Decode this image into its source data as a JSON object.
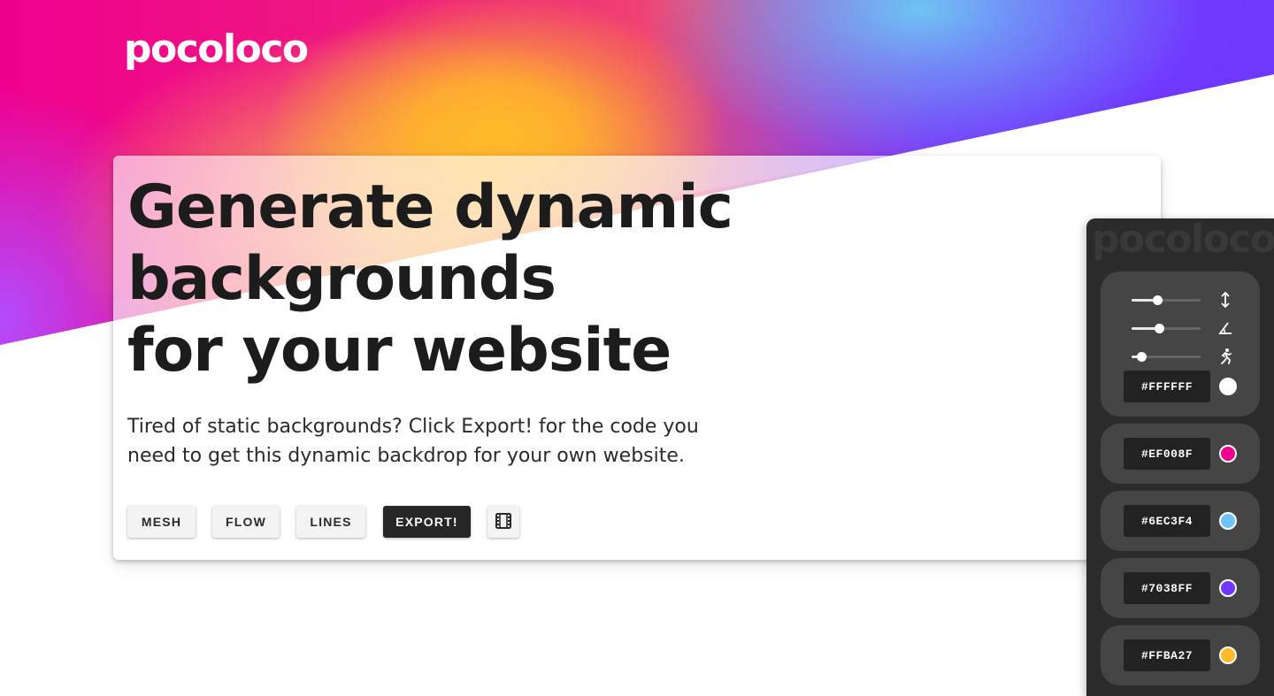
{
  "brand": {
    "logo": "pocoloco"
  },
  "hero": {
    "headline_lines": [
      "Generate dynamic",
      "backgrounds",
      "for your website"
    ],
    "subtext": "Tired of static backgrounds? Click Export! for the code you need to get this dynamic backdrop for your own website."
  },
  "buttons": {
    "mesh": "MESH",
    "flow": "FLOW",
    "lines": "LINES",
    "export": "EXPORT!",
    "fullscreen_icon": "film-icon"
  },
  "panel": {
    "watermark": "pocoloco",
    "sliders": [
      {
        "name": "scale",
        "icon": "vertical-arrows-icon",
        "value": 0.37
      },
      {
        "name": "angle",
        "icon": "angle-icon",
        "value": 0.4
      },
      {
        "name": "speed",
        "icon": "running-person-icon",
        "value": 0.14
      }
    ],
    "colors": [
      {
        "hex_label": "#FFFFFF",
        "hex": "#FFFFFF"
      },
      {
        "hex_label": "#EF008F",
        "hex": "#EF008F"
      },
      {
        "hex_label": "#6EC3F4",
        "hex": "#6EC3F4"
      },
      {
        "hex_label": "#7038FF",
        "hex": "#7038FF"
      },
      {
        "hex_label": "#FFBA27",
        "hex": "#FFBA27"
      }
    ]
  }
}
